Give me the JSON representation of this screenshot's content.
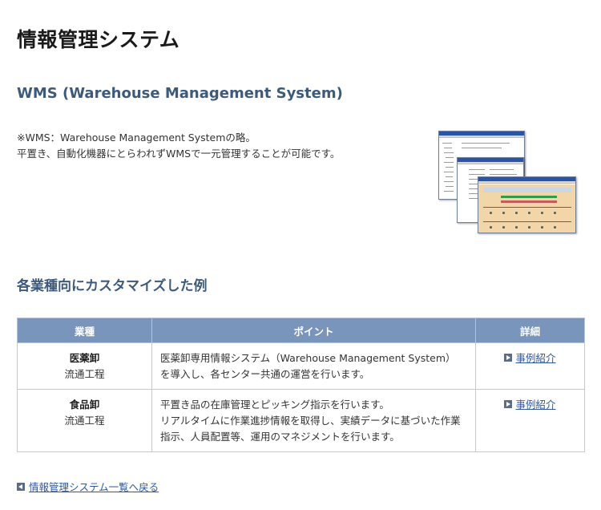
{
  "page": {
    "title": "情報管理システム"
  },
  "wms": {
    "heading": "WMS (Warehouse Management System)",
    "intro_line1": "※WMS：Warehouse Management Systemの略。",
    "intro_line2": "平置き、自動化機器にとらわれずWMSで一元管理することが可能です。"
  },
  "examples": {
    "heading": "各業種向にカスタマイズした例",
    "columns": [
      "業種",
      "ポイント",
      "詳細"
    ],
    "rows": [
      {
        "type": "医薬卸",
        "process": "流通工程",
        "point_line1": "医薬卸専用情報システム（Warehouse Management System）",
        "point_line2": "を導入し、各センター共通の運営を行います。",
        "point_line3": "",
        "detail_link": "事例紹介"
      },
      {
        "type": "食品卸",
        "process": "流通工程",
        "point_line1": "平置き品の在庫管理とピッキング指示を行います。",
        "point_line2": "リアルタイムに作業進捗情報を取得し、実績データに基づいた作業",
        "point_line3": "指示、人員配置等、運用のマネジメントを行います。",
        "detail_link": "事例紹介"
      }
    ]
  },
  "footer": {
    "back_link": "情報管理システム一覧へ戻る"
  },
  "colors": {
    "table_header_bg": "#7a95bb",
    "heading": "#3d5a7a",
    "link": "#2f5aa0"
  },
  "icons": {
    "detail_link": "arrow-right-icon",
    "back_link": "arrow-left-icon"
  }
}
